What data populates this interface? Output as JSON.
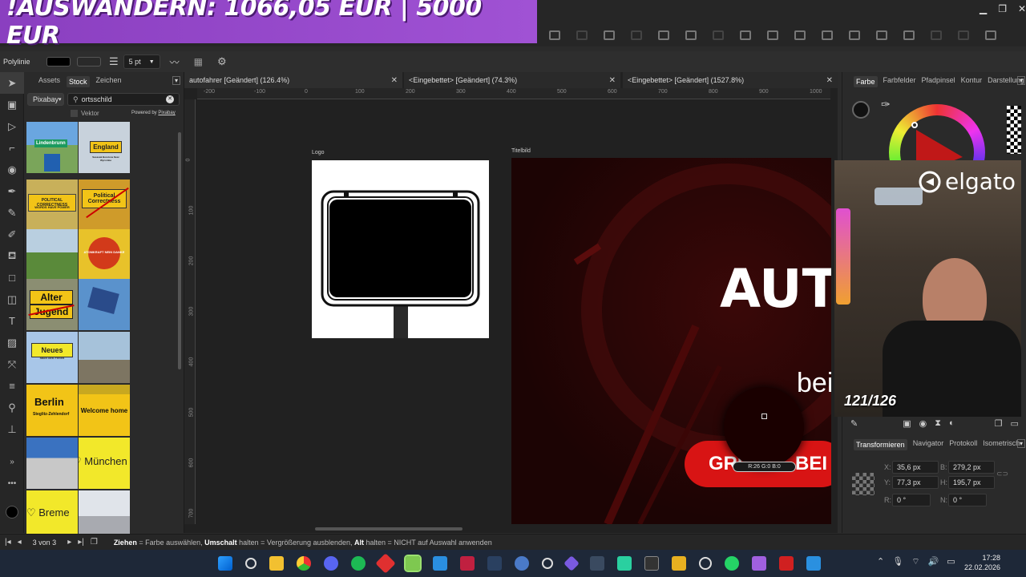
{
  "promo_banner": "!AUSWANDERN: 1066,05 EUR | 5000 EUR",
  "context_bar": {
    "tool_name": "Polylinie",
    "stroke_width": "5 pt"
  },
  "left_panel": {
    "tabs": [
      "Assets",
      "Stock",
      "Zeichen"
    ],
    "provider": "Pixabay",
    "search_value": "ortsschild",
    "vector_label": "Vektor",
    "powered_by": "Powered by",
    "powered_by_brand": "Pixabay",
    "thumbs": {
      "lindenbrunn": "Lindenbrunn",
      "england": "England",
      "england_sub": "Sasasak Boretone Near Wycombe",
      "political": "POLITICAL CORRECTNESS",
      "political_sub": "WORDS HAVE POWER",
      "politcorr": "Political Correctness",
      "atom": "ATOMKRAFT NEIN DANKE",
      "alter": "Alter",
      "jugend": "Jugend",
      "neues": "Neues",
      "neues_sub": "nach den Ferien",
      "berlin": "Berlin",
      "berlin_sub": "Steglitz-Zehlendorf",
      "welcome": "Welcome home",
      "muenchen": "♡ München",
      "bremen": "♡ Breme"
    }
  },
  "doc_tabs": [
    {
      "label": "autofahrer [Geändert] (126.4%)"
    },
    {
      "label": "<Eingebettet> [Geändert] (74.3%)"
    },
    {
      "label": "<Eingebettet> [Geändert] (1527.8%)"
    }
  ],
  "ruler_labels_h": [
    "-200",
    "-100",
    "0",
    "100",
    "200",
    "300",
    "400",
    "500",
    "600",
    "700",
    "800",
    "900",
    "1000"
  ],
  "ruler_labels_v": [
    "0",
    "100",
    "200",
    "300",
    "400",
    "500",
    "600",
    "700"
  ],
  "canvas": {
    "artboard_logo": "Logo",
    "artboard_title": "Titelbild",
    "headline": "AUTO",
    "subline": "bei",
    "cta": "GRÜSSE BEI",
    "color_readout": "R:26 G:0 B:0"
  },
  "right_panel": {
    "tabs": [
      "Farbe",
      "Farbfelder",
      "Pfadpinsel",
      "Kontur",
      "Darstellung"
    ],
    "bottom_tabs": [
      "Transformieren",
      "Navigator",
      "Protokoll",
      "Isometrisch"
    ],
    "transform": {
      "x_label": "X:",
      "x_value": "35,6 px",
      "y_label": "Y:",
      "y_value": "77,3 px",
      "b_label": "B:",
      "b_value": "279,2 px",
      "h_label": "H:",
      "h_value": "195,7 px",
      "r_label": "R:",
      "r_value": "0 °",
      "n_label": "N:",
      "n_value": "0 °"
    }
  },
  "webcam": {
    "brand": "elgato",
    "counter": "121/126"
  },
  "status_bar": {
    "pages": "3 von 3",
    "hint_k1": "Ziehen",
    "hint_t1": " = Farbe auswählen, ",
    "hint_k2": "Umschalt",
    "hint_t2": " halten = Vergrößerung ausblenden, ",
    "hint_k3": "Alt",
    "hint_t3": " halten = NICHT auf Auswahl anwenden"
  },
  "taskbar": {
    "time": "17:28",
    "date": "22.02.2026"
  },
  "colors": {
    "accent_purple": "#9c4dd0",
    "canvas_red": "#e01818",
    "title_bg": "#1c0404"
  }
}
